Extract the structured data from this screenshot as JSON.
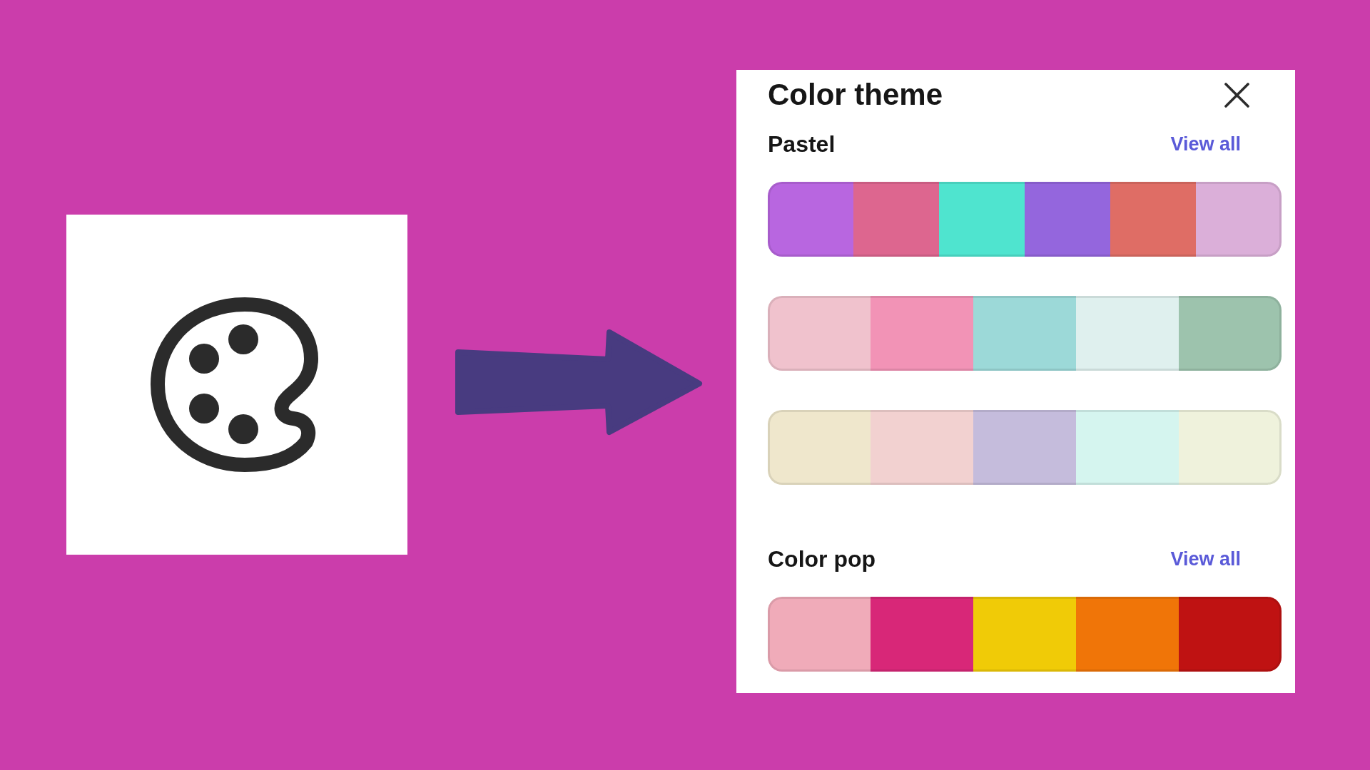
{
  "dialog": {
    "title": "Color theme",
    "sections": [
      {
        "title": "Pastel",
        "link": "View all",
        "palettes": [
          {
            "swatches": [
              {
                "color": "#b866e0"
              },
              {
                "color": "#dd668f"
              },
              {
                "color": "#4fe4cf"
              },
              {
                "color": "#9466dd"
              },
              {
                "color": "#df6d65"
              },
              {
                "color": "#dbafd9"
              }
            ]
          },
          {
            "swatches": [
              {
                "color": "#f0c2cd"
              },
              {
                "color": "#f293b6"
              },
              {
                "color": "#9cd9d8"
              },
              {
                "color": "#dff0ee"
              },
              {
                "color": "#9dc3ad"
              }
            ]
          },
          {
            "swatches": [
              {
                "color": "#efe7cc"
              },
              {
                "color": "#f2d1d0"
              },
              {
                "color": "#c5bcdc"
              },
              {
                "color": "#d5f5ef"
              },
              {
                "color": "#eff2dc"
              }
            ]
          }
        ]
      },
      {
        "title": "Color pop",
        "link": "View all",
        "palettes": [
          {
            "swatches": [
              {
                "color": "#f0abb9"
              },
              {
                "color": "#d82778"
              },
              {
                "color": "#f0cb07"
              },
              {
                "color": "#f07508"
              },
              {
                "color": "#bf1212"
              }
            ]
          }
        ]
      }
    ]
  }
}
